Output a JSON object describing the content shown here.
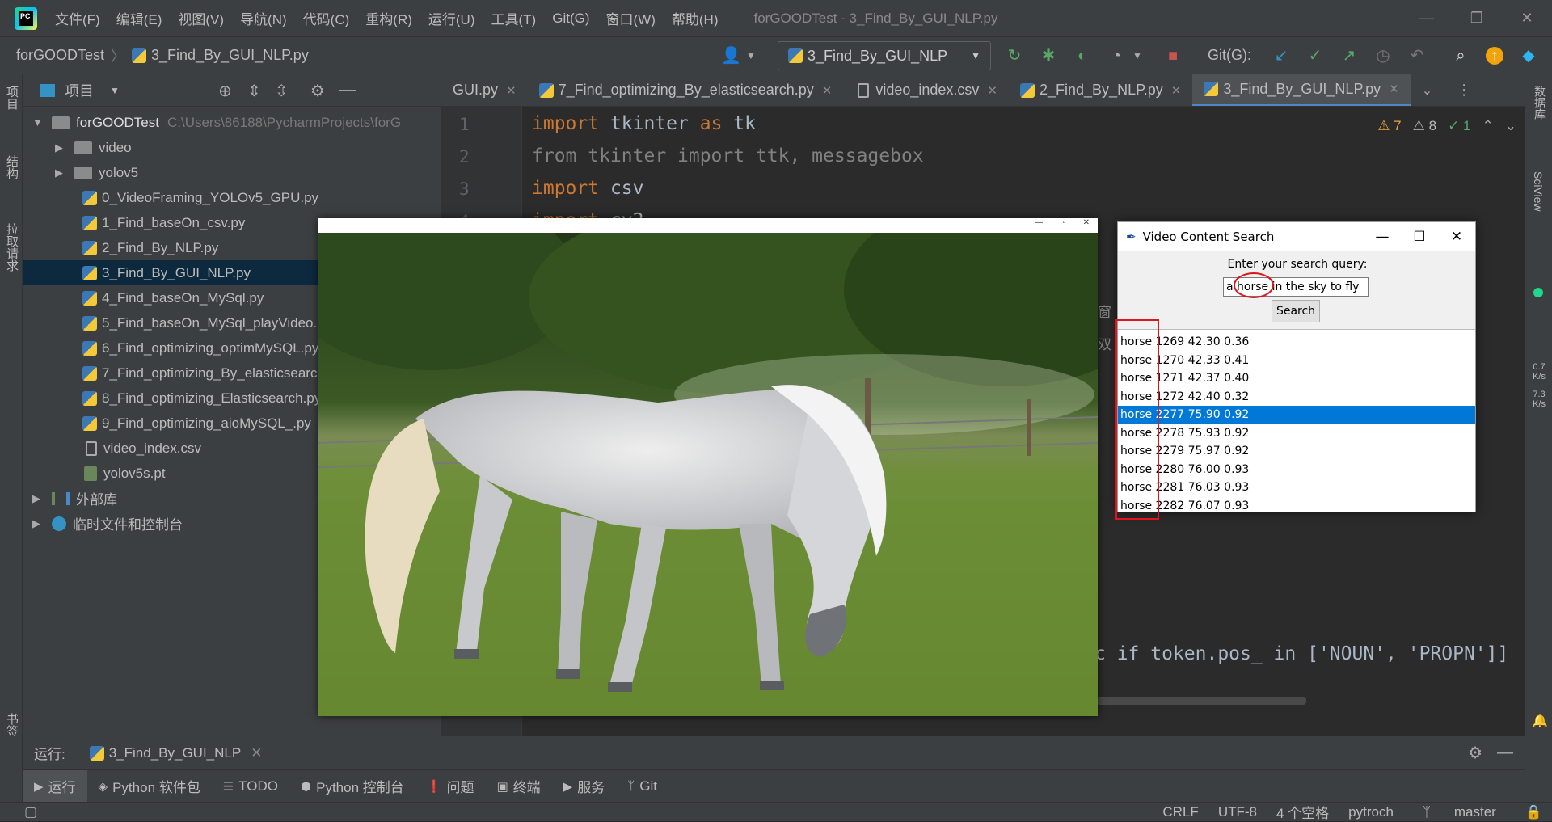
{
  "app": {
    "logo_text": "PC",
    "window_title": "forGOODTest - 3_Find_By_GUI_NLP.py",
    "menu": [
      "文件(F)",
      "编辑(E)",
      "视图(V)",
      "导航(N)",
      "代码(C)",
      "重构(R)",
      "运行(U)",
      "工具(T)",
      "Git(G)",
      "窗口(W)",
      "帮助(H)"
    ]
  },
  "navbar": {
    "project": "forGOODTest",
    "file": "3_Find_By_GUI_NLP.py",
    "run_config": "3_Find_By_GUI_NLP",
    "git_label": "Git(G):"
  },
  "left_strip": [
    "项目",
    "结构",
    "拉取请求",
    "书签"
  ],
  "right_strip": [
    "数据库",
    "SciView"
  ],
  "net_speed": {
    "up": "0.7",
    "up_unit": "K/s",
    "down": "7.3",
    "down_unit": "K/s"
  },
  "project_panel": {
    "title": "项目",
    "root": "forGOODTest",
    "root_path": "C:\\Users\\86188\\PycharmProjects\\forG",
    "folders": [
      "video",
      "yolov5"
    ],
    "files": [
      "0_VideoFraming_YOLOv5_GPU.py",
      "1_Find_baseOn_csv.py",
      "2_Find_By_NLP.py",
      "3_Find_By_GUI_NLP.py",
      "4_Find_baseOn_MySql.py",
      "5_Find_baseOn_MySql_playVideo.py",
      "6_Find_optimizing_optimMySQL.py",
      "7_Find_optimizing_By_elasticsearch.py",
      "8_Find_optimizing_Elasticsearch.py",
      "9_Find_optimizing_aioMySQL_.py"
    ],
    "csv_file": "video_index.csv",
    "pt_file": "yolov5s.pt",
    "external_libs": "外部库",
    "scratches": "临时文件和控制台"
  },
  "editor": {
    "tabs": [
      {
        "label": "GUI.py",
        "active": false
      },
      {
        "label": "7_Find_optimizing_By_elasticsearch.py",
        "active": false
      },
      {
        "label": "video_index.csv",
        "active": false
      },
      {
        "label": "2_Find_By_NLP.py",
        "active": false
      },
      {
        "label": "3_Find_By_GUI_NLP.py",
        "active": true
      }
    ],
    "line_numbers": [
      "1",
      "2",
      "3",
      "4"
    ],
    "inspections": {
      "errors": "7",
      "warnings": "8",
      "ok": "1"
    },
    "code_tail": "c if token.pos_ in ['NOUN', 'PROPN']]",
    "side_chars": [
      "窗",
      "双"
    ]
  },
  "run_window": {
    "label": "运行:",
    "config": "3_Find_By_GUI_NLP"
  },
  "bottom_tabs": [
    "运行",
    "Python 软件包",
    "TODO",
    "Python 控制台",
    "问题",
    "终端",
    "服务",
    "Git"
  ],
  "status_bar": [
    "CRLF",
    "UTF-8",
    "4 个空格",
    "pytroch",
    "master"
  ],
  "search_dialog": {
    "title": "Video Content Search",
    "prompt": "Enter your search query:",
    "query": "a horse in the sky to fly",
    "button": "Search",
    "results": [
      "horse 1269 42.30 0.36",
      "horse 1270 42.33 0.41",
      "horse 1271 42.37 0.40",
      "horse 1272 42.40 0.32",
      "horse 2277 75.90 0.92",
      "horse 2278 75.93 0.92",
      "horse 2279 75.97 0.92",
      "horse 2280 76.00 0.93",
      "horse 2281 76.03 0.93",
      "horse 2282 76.07 0.93"
    ],
    "selected_index": 4
  },
  "colors": {
    "accent": "#0078d7",
    "annotation": "#e0141c",
    "keyword": "#cc7832"
  }
}
